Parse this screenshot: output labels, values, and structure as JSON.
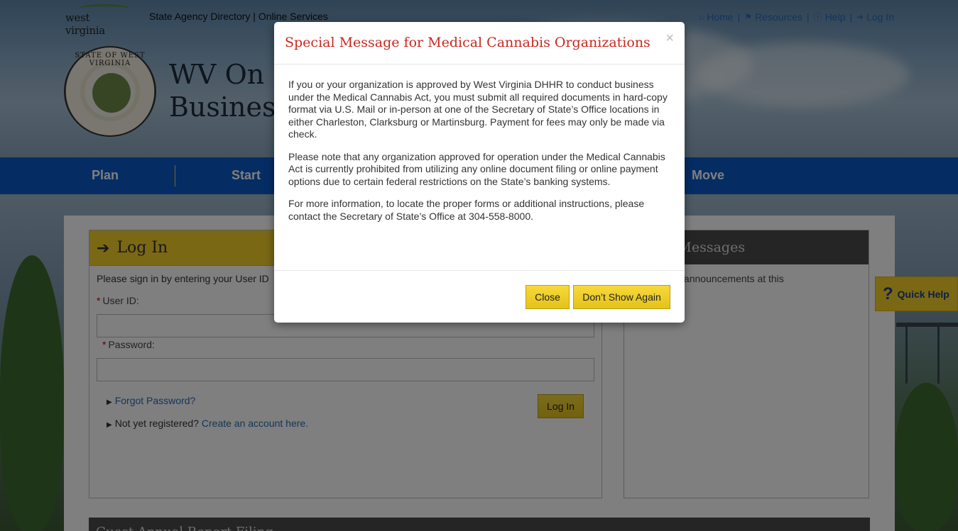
{
  "header": {
    "logo_text": "west virginia",
    "top_links": "State Agency Directory | Online Services",
    "util_nav": [
      {
        "icon": "home-icon",
        "glyph": "⌂",
        "label": "Home"
      },
      {
        "icon": "bookmark-icon",
        "glyph": "⚑",
        "label": "Resources"
      },
      {
        "icon": "info-icon",
        "glyph": "ⓘ",
        "label": "Help"
      },
      {
        "icon": "login-icon",
        "glyph": "➔",
        "label": "Log In"
      }
    ],
    "seal_text": "STATE OF WEST VIRGINIA",
    "site_title_line1": "WV On",
    "site_title_line2": "Busines"
  },
  "nav": {
    "items": [
      "Plan",
      "Start",
      "Move"
    ]
  },
  "login": {
    "title": "Log In",
    "intro": "Please sign in by entering your User ID",
    "user_label": "User ID:",
    "password_label": "Password:",
    "forgot": "Forgot Password?",
    "not_registered": "Not yet registered?",
    "create_account": "Create an account here.",
    "button": "Log In"
  },
  "messages": {
    "title": "ortant Messages",
    "body": "o important announcements at this"
  },
  "guest": {
    "title": "Guest Annual Report Filing"
  },
  "quick_help": {
    "label": "Quick Help"
  },
  "modal": {
    "title": "Special Message for Medical Cannabis Organizations",
    "close_glyph": "×",
    "paragraphs": [
      "If you or your organization is approved by West Virginia DHHR to conduct business under the Medical Cannabis Act, you must submit all required documents in hard-copy format via U.S. Mail or in-person at one of the Secretary of State’s Office locations in either Charleston, Clarksburg or Martinsburg. Payment for fees may only be made via check.",
      "Please note that any organization approved for operation under the Medical Cannabis Act is currently prohibited from utilizing any online document filing or online payment options due to certain federal restrictions on the State’s banking systems.",
      "For more information, to locate the proper forms or additional instructions, please contact the Secretary of State’s Office at 304-558-8000."
    ],
    "close_button": "Close",
    "dont_show_button": "Don’t Show Again"
  },
  "colors": {
    "nav_blue": "#0b5bc8",
    "accent_yellow": "#f4d12a",
    "title_red": "#c9271e",
    "link_blue": "#2a6ab3"
  }
}
